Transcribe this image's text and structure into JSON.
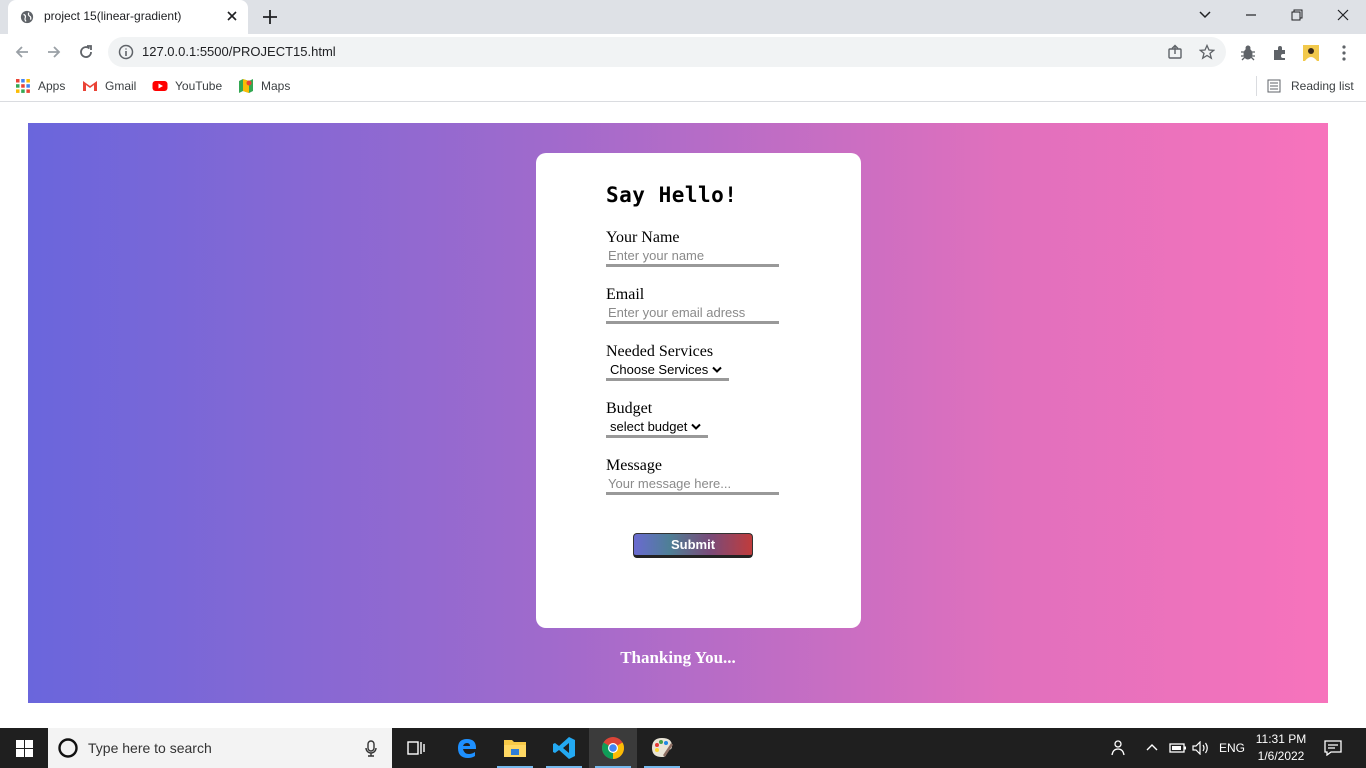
{
  "browser": {
    "tab_title": "project 15(linear-gradient)",
    "url": "127.0.0.1:5500/PROJECT15.html",
    "bookmarks": [
      "Apps",
      "Gmail",
      "YouTube",
      "Maps"
    ],
    "reading_list": "Reading list"
  },
  "form": {
    "heading": "Say Hello!",
    "name_label": "Your Name",
    "name_placeholder": "Enter your name",
    "email_label": "Email",
    "email_placeholder": "Enter your email adress",
    "services_label": "Needed Services",
    "services_value": "Choose Services",
    "budget_label": "Budget",
    "budget_value": "select budget",
    "message_label": "Message",
    "message_placeholder": "Your message here...",
    "submit_label": "Submit"
  },
  "footer_text": "Thanking You...",
  "taskbar": {
    "search_placeholder": "Type here to search",
    "language": "ENG",
    "time": "11:31 PM",
    "date": "1/6/2022"
  },
  "colors": {
    "gradient_start": "#6a66dc",
    "gradient_end": "#f773bc",
    "taskbar": "#1f1f1f"
  }
}
